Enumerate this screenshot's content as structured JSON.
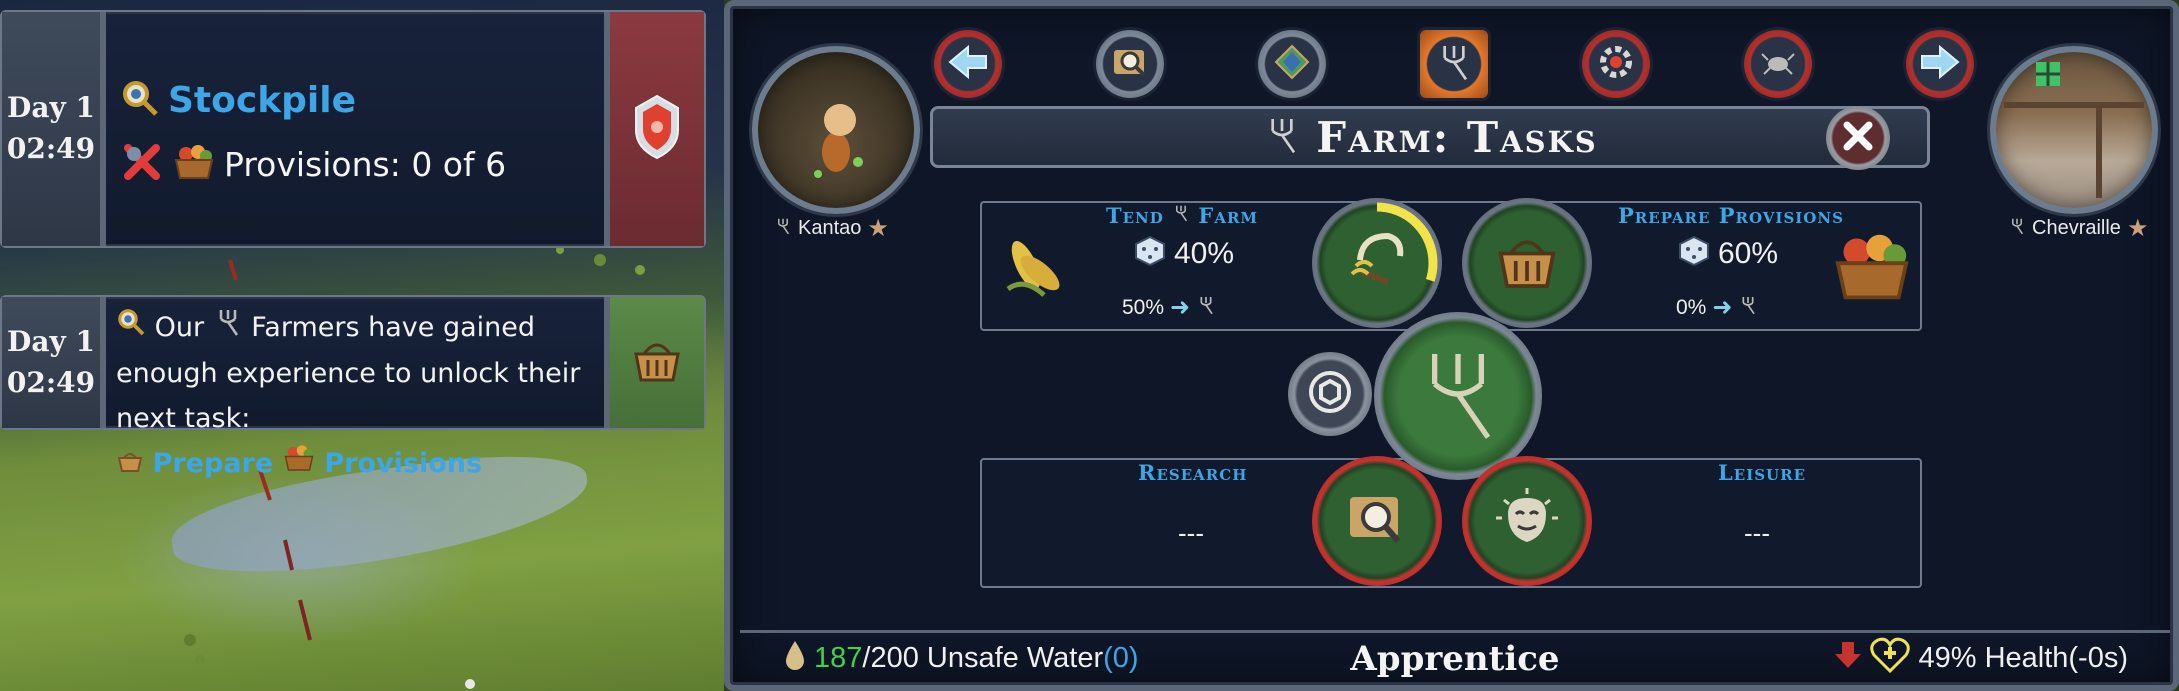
{
  "notifications": [
    {
      "day": "Day 1",
      "time": "02:49",
      "title": "Stockpile",
      "provisions_text": "Provisions: 0 of 6",
      "icons": [
        "magnifier-icon",
        "cancel-x-icon",
        "provisions-basket-icon",
        "shield-marker-icon"
      ]
    },
    {
      "day": "Day 1",
      "time": "02:49",
      "text_part1": "Our",
      "text_part2": "Farmers have gained enough experience to unlock their next task:",
      "link1": "Prepare",
      "link2": "Provisions",
      "icons": [
        "magnifier-icon",
        "pitchfork-icon",
        "basket-icon"
      ]
    }
  ],
  "panel": {
    "title": "Farm: Tasks",
    "left_villager": "Kantao",
    "right_villager": "Chevraille",
    "nav_icons": [
      "back-arrow-icon",
      "inspect-icon",
      "map-icon",
      "farm-pitchfork-icon",
      "settings-gear-icon",
      "disease-icon",
      "forward-arrow-icon"
    ]
  },
  "tasks": {
    "tend_farm": {
      "label_a": "Tend",
      "label_b": "Farm",
      "chance": "40%",
      "rate": "50%",
      "progress": 0.3
    },
    "prepare_provisions": {
      "label": "Prepare Provisions",
      "chance": "60%",
      "rate": "0%"
    },
    "research": {
      "label": "Research",
      "value": "---"
    },
    "leisure": {
      "label": "Leisure",
      "value": "---"
    }
  },
  "status": {
    "water_current": "187",
    "water_rest": "/200 Unsafe Water",
    "water_extra": "(0)",
    "rank": "Apprentice",
    "health": "49% Health(-0s)"
  },
  "colors": {
    "link_blue": "#3ca6e6",
    "water_green": "#3fd34a",
    "water_blue": "#3ca6e6",
    "health_yellow": "#f1e34a",
    "alert_red": "#c4332f"
  }
}
